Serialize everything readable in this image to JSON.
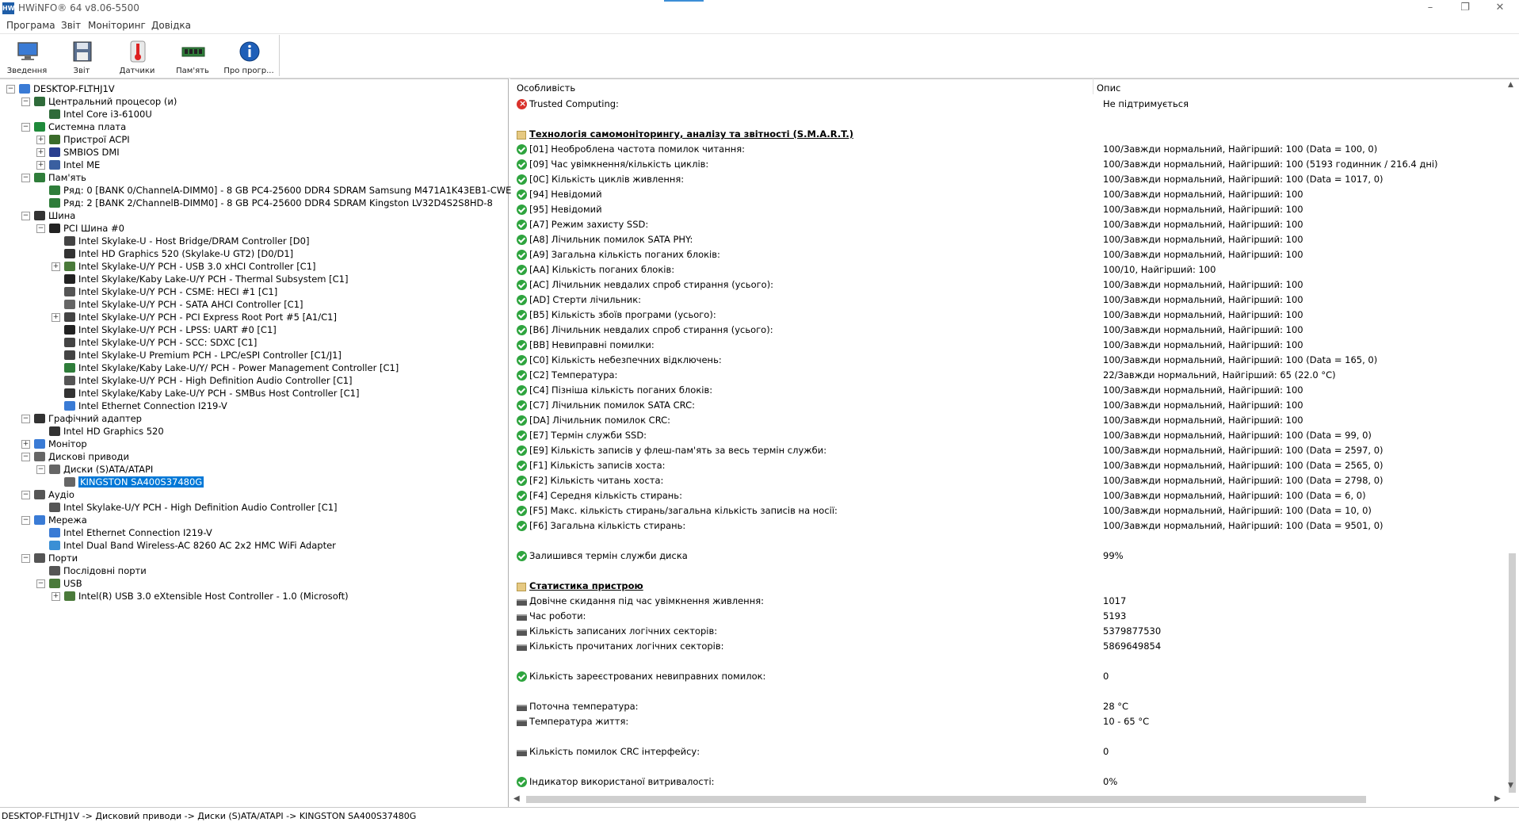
{
  "window": {
    "title": "HWiNFO® 64 v8.06-5500",
    "controls": {
      "minimize": "–",
      "restore": "❐",
      "close": "✕"
    }
  },
  "menu": [
    "Програма",
    "Звіт",
    "Моніторинг",
    "Довідка"
  ],
  "toolbar": [
    {
      "label": "Зведення",
      "icon": "monitor-icon"
    },
    {
      "label": "Звіт",
      "icon": "floppy-save-icon"
    },
    {
      "label": "Датчики",
      "icon": "thermometer-icon"
    },
    {
      "label": "Пам'ять",
      "icon": "memory-module-icon"
    },
    {
      "label": "Про прогр...",
      "icon": "info-icon"
    }
  ],
  "tree": [
    {
      "label": "DESKTOP-FLTHJ1V",
      "level": 0,
      "expander": "−",
      "icon": "computer-icon"
    },
    {
      "label": "Центральний процесор (и)",
      "level": 1,
      "expander": "−",
      "icon": "cpu-icon"
    },
    {
      "label": "Intel Core i3-6100U",
      "level": 2,
      "expander": "",
      "icon": "cpu-icon"
    },
    {
      "label": "Системна плата",
      "level": 1,
      "expander": "−",
      "icon": "motherboard-icon"
    },
    {
      "label": "Пристрої ACPI",
      "level": 2,
      "expander": "+",
      "icon": "acpi-icon"
    },
    {
      "label": "SMBIOS DMI",
      "level": 2,
      "expander": "+",
      "icon": "dmi-icon"
    },
    {
      "label": "Intel ME",
      "level": 2,
      "expander": "+",
      "icon": "gear-icon"
    },
    {
      "label": "Пам'ять",
      "level": 1,
      "expander": "−",
      "icon": "memory-module-icon"
    },
    {
      "label": "Ряд: 0 [BANK 0/ChannelA-DIMM0] - 8 GB PC4-25600 DDR4 SDRAM Samsung M471A1K43EB1-CWE",
      "level": 2,
      "expander": "",
      "icon": "memory-module-icon"
    },
    {
      "label": "Ряд: 2 [BANK 2/ChannelB-DIMM0] - 8 GB PC4-25600 DDR4 SDRAM Kingston LV32D4S2S8HD-8",
      "level": 2,
      "expander": "",
      "icon": "memory-module-icon"
    },
    {
      "label": "Шина",
      "level": 1,
      "expander": "−",
      "icon": "bus-icon"
    },
    {
      "label": "PCI Шина #0",
      "level": 2,
      "expander": "−",
      "icon": "pci-icon"
    },
    {
      "label": "Intel Skylake-U - Host Bridge/DRAM Controller [D0]",
      "level": 3,
      "expander": "",
      "icon": "chip-icon"
    },
    {
      "label": "Intel HD Graphics 520 (Skylake-U GT2) [D0/D1]",
      "level": 3,
      "expander": "",
      "icon": "gpu-icon"
    },
    {
      "label": "Intel Skylake-U/Y PCH - USB 3.0 xHCI Controller  [C1]",
      "level": 3,
      "expander": "+",
      "icon": "usb-icon"
    },
    {
      "label": "Intel Skylake/Kaby Lake-U/Y PCH - Thermal Subsystem [C1]",
      "level": 3,
      "expander": "",
      "icon": "pci-icon"
    },
    {
      "label": "Intel Skylake-U/Y PCH - CSME: HECI #1 [C1]",
      "level": 3,
      "expander": "",
      "icon": "plug-icon"
    },
    {
      "label": "Intel Skylake-U/Y PCH - SATA AHCI Controller [C1]",
      "level": 3,
      "expander": "",
      "icon": "drive-icon"
    },
    {
      "label": "Intel Skylake-U/Y PCH - PCI Express Root Port #5 [A1/C1]",
      "level": 3,
      "expander": "+",
      "icon": "chip-icon"
    },
    {
      "label": "Intel Skylake-U/Y PCH - LPSS: UART #0 [C1]",
      "level": 3,
      "expander": "",
      "icon": "pci-icon"
    },
    {
      "label": "Intel Skylake-U/Y PCH - SCC: SDXC [C1]",
      "level": 3,
      "expander": "",
      "icon": "chip-icon"
    },
    {
      "label": "Intel Skylake-U Premium PCH - LPC/eSPI Controller [C1/J1]",
      "level": 3,
      "expander": "",
      "icon": "chip-icon"
    },
    {
      "label": "Intel Skylake/Kaby Lake-U/Y/ PCH - Power Management Controller [C1]",
      "level": 3,
      "expander": "",
      "icon": "memory-module-icon"
    },
    {
      "label": "Intel Skylake-U/Y PCH - High Definition Audio Controller [C1]",
      "level": 3,
      "expander": "",
      "icon": "speaker-icon"
    },
    {
      "label": "Intel Skylake/Kaby Lake-U/Y PCH - SMBus Host Controller [C1]",
      "level": 3,
      "expander": "",
      "icon": "bus-icon"
    },
    {
      "label": "Intel Ethernet Connection I219-V",
      "level": 3,
      "expander": "",
      "icon": "network-icon"
    },
    {
      "label": "Графічний адаптер",
      "level": 1,
      "expander": "−",
      "icon": "gpu-icon"
    },
    {
      "label": "Intel HD Graphics 520",
      "level": 2,
      "expander": "",
      "icon": "gpu-icon"
    },
    {
      "label": "Монітор",
      "level": 1,
      "expander": "+",
      "icon": "monitor-icon"
    },
    {
      "label": "Дискові приводи",
      "level": 1,
      "expander": "−",
      "icon": "drives-icon"
    },
    {
      "label": "Диски (S)ATA/ATAPI",
      "level": 2,
      "expander": "−",
      "icon": "drive-icon"
    },
    {
      "label": "KINGSTON SA400S37480G",
      "level": 3,
      "expander": "",
      "icon": "drive-icon",
      "selected": true
    },
    {
      "label": "Аудіо",
      "level": 1,
      "expander": "−",
      "icon": "speaker-icon"
    },
    {
      "label": "Intel Skylake-U/Y PCH - High Definition Audio Controller [C1]",
      "level": 2,
      "expander": "",
      "icon": "speaker-icon"
    },
    {
      "label": "Мережа",
      "level": 1,
      "expander": "−",
      "icon": "network-icon"
    },
    {
      "label": "Intel Ethernet Connection I219-V",
      "level": 2,
      "expander": "",
      "icon": "network-icon"
    },
    {
      "label": "Intel Dual Band Wireless-AC 8260 AC 2x2 HMC WiFi Adapter",
      "level": 2,
      "expander": "",
      "icon": "wifi-icon"
    },
    {
      "label": "Порти",
      "level": 1,
      "expander": "−",
      "icon": "plug-icon"
    },
    {
      "label": "Послідовні порти",
      "level": 2,
      "expander": "",
      "icon": "plug-icon"
    },
    {
      "label": "USB",
      "level": 2,
      "expander": "−",
      "icon": "usb-icon"
    },
    {
      "label": "Intel(R) USB 3.0 eXtensible Host Controller - 1.0 (Microsoft)",
      "level": 3,
      "expander": "+",
      "icon": "usb-icon"
    }
  ],
  "details": {
    "columns": {
      "feature": "Особливість",
      "description": "Опис"
    },
    "rows": [
      {
        "icon": "err",
        "name": "Trusted Computing:",
        "value": "Не підтримується"
      },
      {
        "icon": "blank",
        "name": "",
        "value": ""
      },
      {
        "icon": "sect",
        "name": "Технологія самомоніторингу, аналізу та звітності (S.M.A.R.T.)",
        "value": "",
        "section": true
      },
      {
        "icon": "ok",
        "name": "[01] Необроблена частота помилок читання:",
        "value": "100/Завжди нормальний, Найгірший: 100 (Data = 100, 0)"
      },
      {
        "icon": "ok",
        "name": "[09] Час увімкнення/кількість циклів:",
        "value": "100/Завжди нормальний, Найгірший: 100 (5193 годинник / 216.4 дні)"
      },
      {
        "icon": "ok",
        "name": "[0C] Кількість циклів живлення:",
        "value": "100/Завжди нормальний, Найгірший: 100 (Data = 1017, 0)"
      },
      {
        "icon": "ok",
        "name": "[94] Невідомий",
        "value": "100/Завжди нормальний, Найгірший: 100"
      },
      {
        "icon": "ok",
        "name": "[95] Невідомий",
        "value": "100/Завжди нормальний, Найгірший: 100"
      },
      {
        "icon": "ok",
        "name": "[A7] Режим захисту SSD:",
        "value": "100/Завжди нормальний, Найгірший: 100"
      },
      {
        "icon": "ok",
        "name": "[A8] Лічильник помилок SATA PHY:",
        "value": "100/Завжди нормальний, Найгірший: 100"
      },
      {
        "icon": "ok",
        "name": "[A9] Загальна кількість поганих блоків:",
        "value": "100/Завжди нормальний, Найгірший: 100"
      },
      {
        "icon": "ok",
        "name": "[AA] Кількість поганих блоків:",
        "value": "100/10, Найгірший: 100"
      },
      {
        "icon": "ok",
        "name": "[AC] Лічильник невдалих спроб стирання (усього):",
        "value": "100/Завжди нормальний, Найгірший: 100"
      },
      {
        "icon": "ok",
        "name": "[AD] Стерти лічильник:",
        "value": "100/Завжди нормальний, Найгірший: 100"
      },
      {
        "icon": "ok",
        "name": "[B5] Кількість збоїв програми (усього):",
        "value": "100/Завжди нормальний, Найгірший: 100"
      },
      {
        "icon": "ok",
        "name": "[B6] Лічильник невдалих спроб стирання (усього):",
        "value": "100/Завжди нормальний, Найгірший: 100"
      },
      {
        "icon": "ok",
        "name": "[BB] Невиправні помилки:",
        "value": "100/Завжди нормальний, Найгірший: 100"
      },
      {
        "icon": "ok",
        "name": "[C0] Кількість небезпечних відключень:",
        "value": "100/Завжди нормальний, Найгірший: 100 (Data = 165, 0)"
      },
      {
        "icon": "ok",
        "name": "[C2] Температура:",
        "value": "22/Завжди нормальний, Найгірший: 65 (22.0 °C)"
      },
      {
        "icon": "ok",
        "name": "[C4] Пізніша кількість поганих блоків:",
        "value": "100/Завжди нормальний, Найгірший: 100"
      },
      {
        "icon": "ok",
        "name": "[C7] Лічильник помилок SATA CRC:",
        "value": "100/Завжди нормальний, Найгірший: 100"
      },
      {
        "icon": "ok",
        "name": "[DA] Лічильник помилок CRC:",
        "value": "100/Завжди нормальний, Найгірший: 100"
      },
      {
        "icon": "ok",
        "name": "[E7] Термін служби SSD:",
        "value": "100/Завжди нормальний, Найгірший: 100 (Data = 99, 0)"
      },
      {
        "icon": "ok",
        "name": "[E9] Кількість записів у флеш-пам'ять за весь термін служби:",
        "value": "100/Завжди нормальний, Найгірший: 100 (Data = 2597, 0)"
      },
      {
        "icon": "ok",
        "name": "[F1] Кількість записів хоста:",
        "value": "100/Завжди нормальний, Найгірший: 100 (Data = 2565, 0)"
      },
      {
        "icon": "ok",
        "name": "[F2] Кількість читань хоста:",
        "value": "100/Завжди нормальний, Найгірший: 100 (Data = 2798, 0)"
      },
      {
        "icon": "ok",
        "name": "[F4] Середня кількість стирань:",
        "value": "100/Завжди нормальний, Найгірший: 100 (Data = 6, 0)"
      },
      {
        "icon": "ok",
        "name": "[F5] Макс. кількість стирань/загальна кількість записів на носії:",
        "value": "100/Завжди нормальний, Найгірший: 100 (Data = 10, 0)"
      },
      {
        "icon": "ok",
        "name": "[F6] Загальна кількість стирань:",
        "value": "100/Завжди нормальний, Найгірший: 100 (Data = 9501, 0)"
      },
      {
        "icon": "blank",
        "name": "",
        "value": ""
      },
      {
        "icon": "ok",
        "name": "Залишився термін служби диска",
        "value": "99%"
      },
      {
        "icon": "blank",
        "name": "",
        "value": ""
      },
      {
        "icon": "sect",
        "name": "Статистика пристрою",
        "value": "",
        "section": true
      },
      {
        "icon": "drive",
        "name": "Довічне скидання під час увімкнення живлення:",
        "value": "1017"
      },
      {
        "icon": "drive",
        "name": "Час роботи:",
        "value": "5193"
      },
      {
        "icon": "drive",
        "name": "Кількість записаних логічних секторів:",
        "value": "5379877530"
      },
      {
        "icon": "drive",
        "name": "Кількість прочитаних логічних секторів:",
        "value": "5869649854"
      },
      {
        "icon": "blank",
        "name": "",
        "value": ""
      },
      {
        "icon": "ok",
        "name": "Кількість зареєстрованих невиправних помилок:",
        "value": "0"
      },
      {
        "icon": "blank",
        "name": "",
        "value": ""
      },
      {
        "icon": "drive",
        "name": "Поточна температура:",
        "value": "28 °C"
      },
      {
        "icon": "drive",
        "name": "Температура життя:",
        "value": "10 - 65 °C"
      },
      {
        "icon": "blank",
        "name": "",
        "value": ""
      },
      {
        "icon": "drive",
        "name": "Кількість помилок CRC інтерфейсу:",
        "value": "0"
      },
      {
        "icon": "blank",
        "name": "",
        "value": ""
      },
      {
        "icon": "ok",
        "name": "Індикатор використаної витривалості:",
        "value": "0%"
      }
    ]
  },
  "statusbar": {
    "path": "DESKTOP-FLTHJ1V -> Дисковий приводи -> Диски (S)ATA/ATAPI -> KINGSTON SA400S37480G"
  }
}
